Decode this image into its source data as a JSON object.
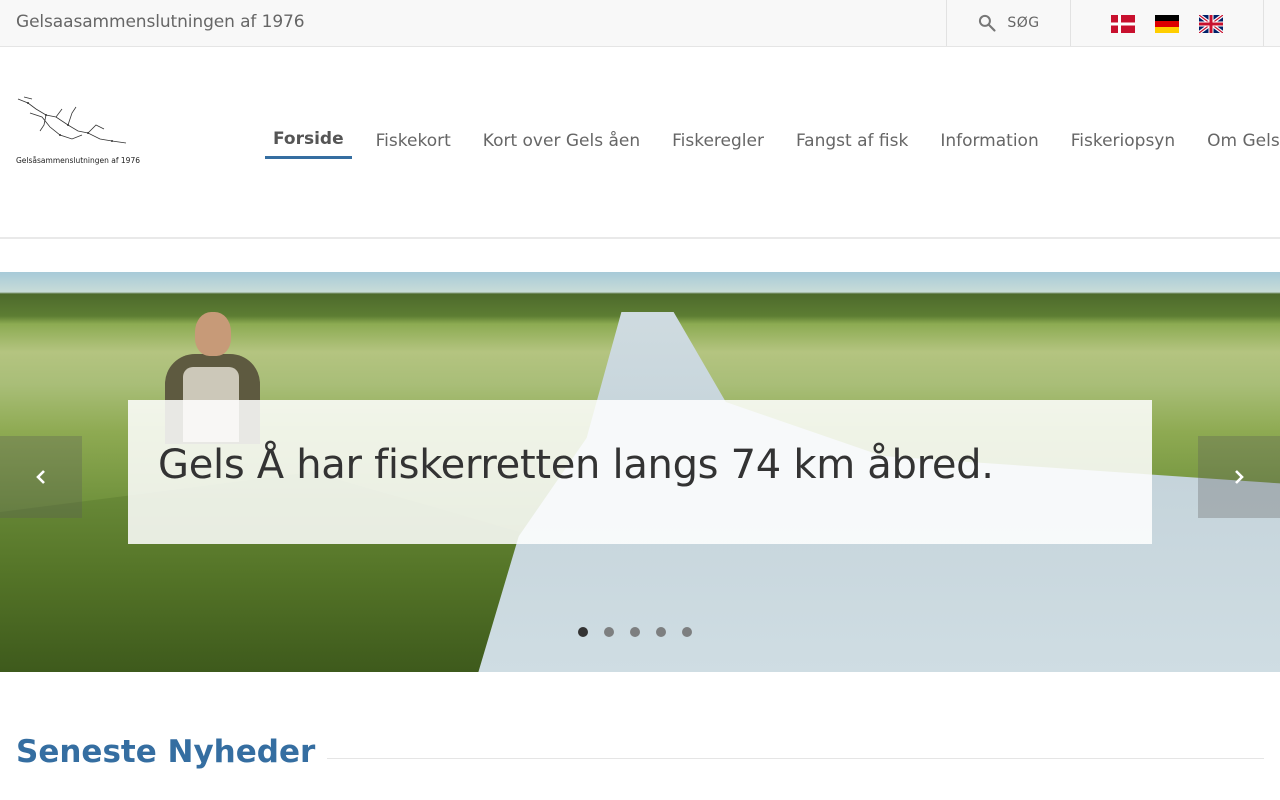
{
  "topbar": {
    "site_name": "Gelsaasammenslutningen af 1976",
    "search_label": "SØG",
    "languages": [
      {
        "name": "dansk",
        "icon": "flag-denmark-icon"
      },
      {
        "name": "deutsch",
        "icon": "flag-germany-icon"
      },
      {
        "name": "english",
        "icon": "flag-uk-icon"
      }
    ]
  },
  "header": {
    "logo_caption": "Gelsåsammenslutningen af 1976",
    "nav": [
      {
        "label": "Forside",
        "active": true
      },
      {
        "label": "Fiskekort"
      },
      {
        "label": "Kort over Gels åen"
      },
      {
        "label": "Fiskeregler"
      },
      {
        "label": "Fangst af fisk"
      },
      {
        "label": "Information"
      },
      {
        "label": "Fiskeriopsyn"
      },
      {
        "label": "Om Gelsåen"
      }
    ]
  },
  "hero": {
    "caption": "Gels Å har fiskerretten langs 74 km åbred.",
    "slide_count": 5,
    "active_slide": 1,
    "prev_icon": "chevron-left-icon",
    "next_icon": "chevron-right-icon"
  },
  "news": {
    "title": "Seneste Nyheder"
  },
  "colors": {
    "accent": "#356ea1",
    "topbar_bg": "#f8f8f8",
    "text": "#666666"
  }
}
